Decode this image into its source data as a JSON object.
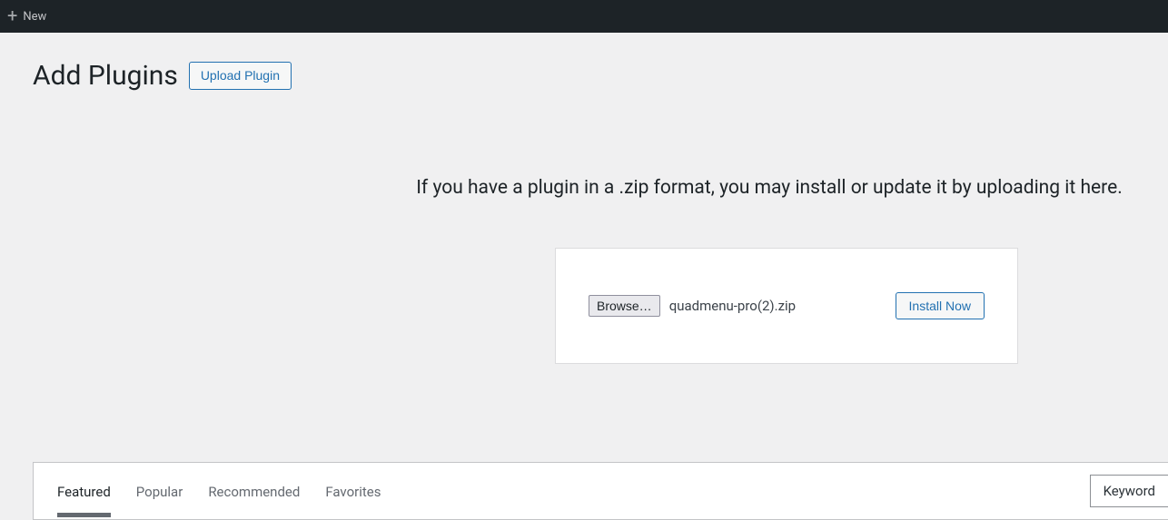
{
  "adminBar": {
    "newLabel": "New"
  },
  "header": {
    "title": "Add Plugins",
    "uploadButton": "Upload Plugin"
  },
  "uploadSection": {
    "info": "If you have a plugin in a .zip format, you may install or update it by uploading it here.",
    "browseLabel": "Browse…",
    "fileName": "quadmenu-pro(2).zip",
    "installNow": "Install Now"
  },
  "filterTabs": {
    "items": [
      {
        "label": "Featured",
        "active": true
      },
      {
        "label": "Popular",
        "active": false
      },
      {
        "label": "Recommended",
        "active": false
      },
      {
        "label": "Favorites",
        "active": false
      }
    ],
    "searchType": "Keyword"
  }
}
